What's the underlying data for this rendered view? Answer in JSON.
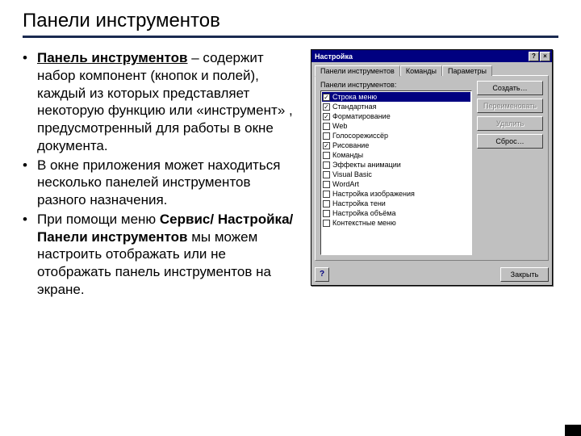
{
  "slide": {
    "title": "Панели инструментов",
    "bullets": [
      {
        "prefix": "Панель инструментов",
        "prefix_style": "underline-bold",
        "rest": " – содержит набор компонент (кнопок и полей), каждый из которых представляет некоторую функцию или «инструмент» , предусмотренный для работы в окне документа."
      },
      {
        "prefix": "",
        "rest": "В окне приложения может находиться несколько панелей инструментов разного назначения."
      },
      {
        "prefix": "",
        "rest_before": "При помощи меню ",
        "rest_bold": "Сервис/ Настройка/Панели инструментов",
        "rest_after": " мы можем настроить отображать или не отображать панель инструментов на экране."
      }
    ]
  },
  "dialog": {
    "title": "Настройка",
    "help_glyph": "?",
    "close_glyph": "×",
    "tabs": [
      "Панели инструментов",
      "Команды",
      "Параметры"
    ],
    "active_tab": 0,
    "list_label": "Панели инструментов:",
    "items": [
      {
        "label": "Строка меню",
        "checked": true,
        "selected": true
      },
      {
        "label": "Стандартная",
        "checked": true
      },
      {
        "label": "Форматирование",
        "checked": true
      },
      {
        "label": "Web",
        "checked": false
      },
      {
        "label": "Голосорежиссёр",
        "checked": false
      },
      {
        "label": "Рисование",
        "checked": true
      },
      {
        "label": "Команды",
        "checked": false
      },
      {
        "label": "Эффекты анимации",
        "checked": false
      },
      {
        "label": "Visual Basic",
        "checked": false
      },
      {
        "label": "WordArt",
        "checked": false
      },
      {
        "label": "Настройка изображения",
        "checked": false
      },
      {
        "label": "Настройка тени",
        "checked": false
      },
      {
        "label": "Настройка объёма",
        "checked": false
      },
      {
        "label": "Контекстные меню",
        "checked": false
      }
    ],
    "buttons": {
      "create": "Создать…",
      "rename": "Переименовать",
      "delete": "Удалить",
      "reset": "Сброс…"
    },
    "close_btn": "Закрыть",
    "help_footer": "?"
  }
}
